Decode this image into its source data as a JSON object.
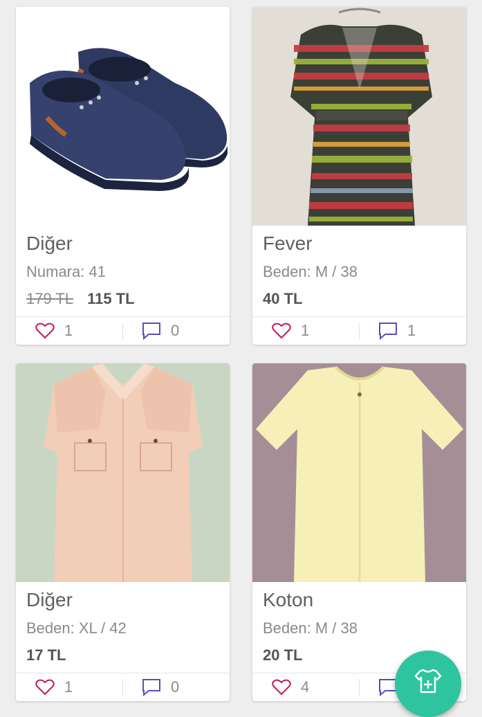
{
  "products": [
    {
      "brand": "Diğer",
      "size": "Numara: 41",
      "old_price": "179 TL",
      "price": "115 TL",
      "likes": "1",
      "comments": "0"
    },
    {
      "brand": "Fever",
      "size": "Beden: M / 38",
      "old_price": "",
      "price": "40 TL",
      "likes": "1",
      "comments": "1"
    },
    {
      "brand": "Diğer",
      "size": "Beden: XL / 42",
      "old_price": "",
      "price": "17 TL",
      "likes": "1",
      "comments": "0"
    },
    {
      "brand": "Koton",
      "size": "Beden: M / 38",
      "old_price": "",
      "price": "20 TL",
      "likes": "4",
      "comments": ""
    }
  ],
  "colors": {
    "accent": "#2ec4a0",
    "heart": "#c2185b",
    "comment": "#5c4bb8"
  },
  "icons": {
    "like": "heart-icon",
    "comment": "comment-icon",
    "fab": "add-shirt-icon"
  }
}
